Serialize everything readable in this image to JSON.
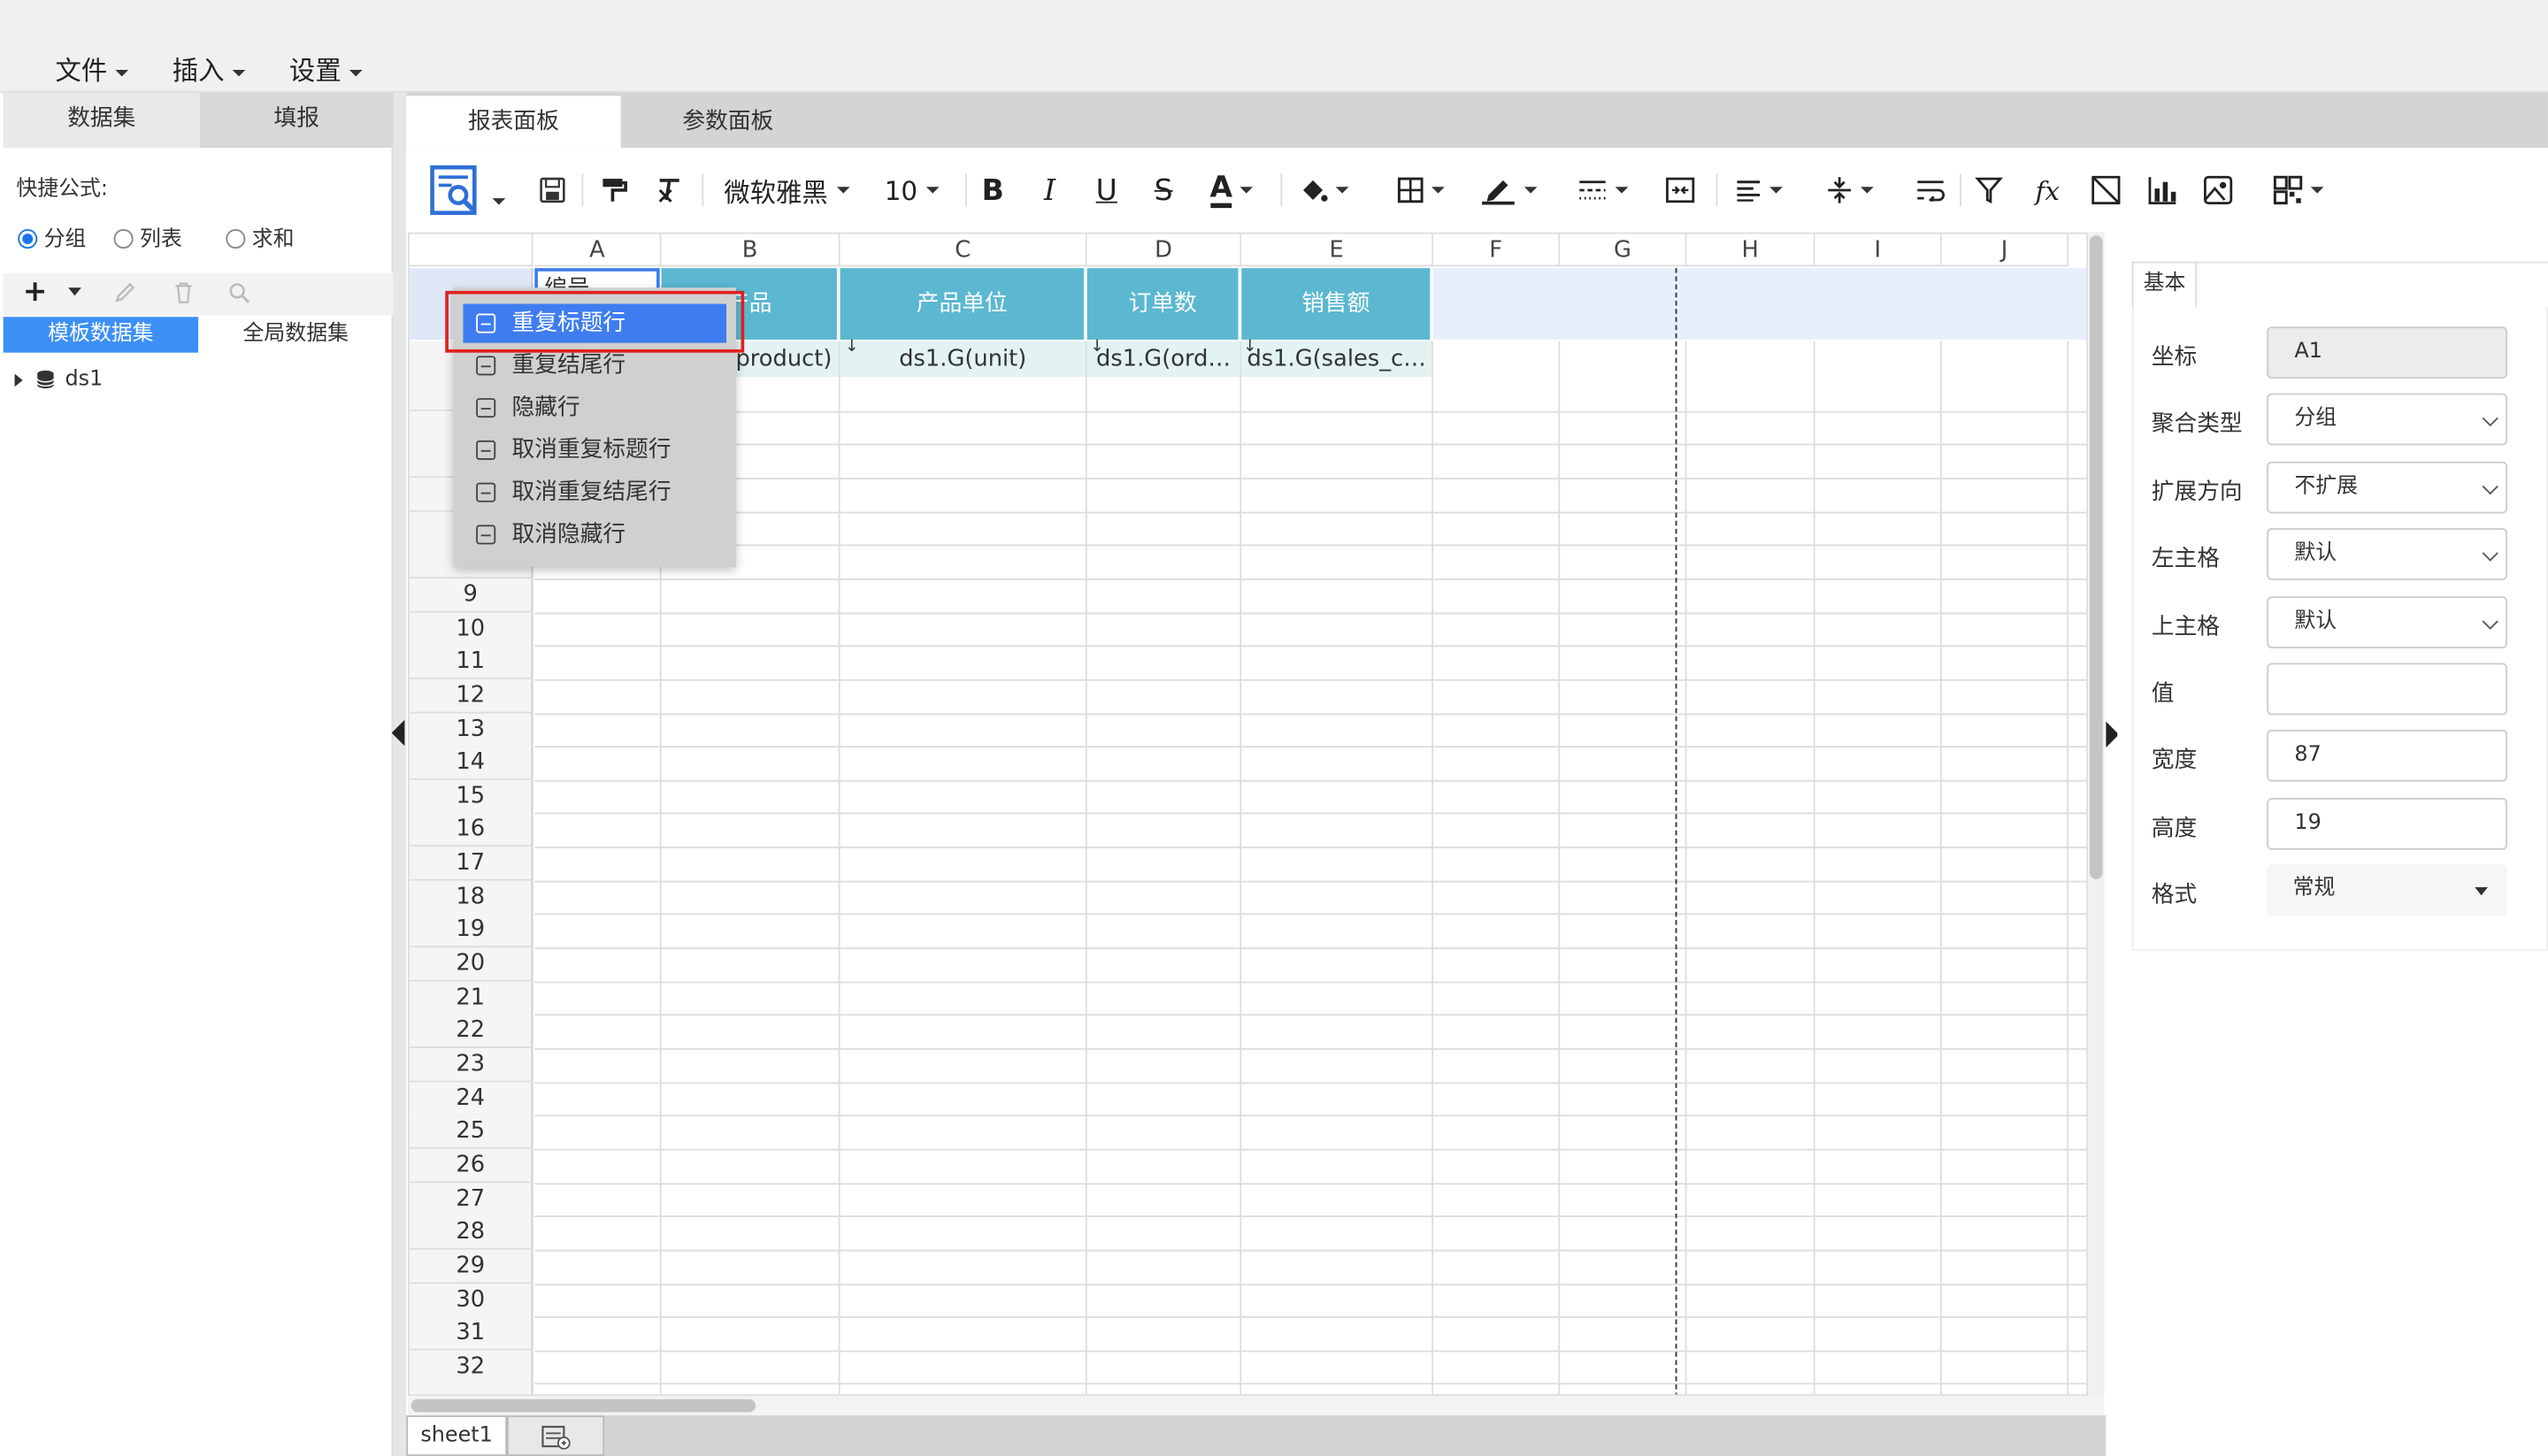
{
  "menu": {
    "file": "文件",
    "insert": "插入",
    "settings": "设置"
  },
  "left_tabs": {
    "dataset": "数据集",
    "fill": "填报"
  },
  "quick_formula": {
    "label": "快捷公式:",
    "options": [
      "分组",
      "列表",
      "求和"
    ],
    "selected": "分组"
  },
  "dataset_tabs": {
    "template": "模板数据集",
    "global": "全局数据集"
  },
  "tree": {
    "root": "ds1"
  },
  "right_tabs": {
    "report": "报表面板",
    "param": "参数面板"
  },
  "toolbar": {
    "font_name": "微软雅黑",
    "font_size": "10",
    "bold": "B",
    "italic": "I",
    "underline": "U",
    "strike": "S",
    "font_color": "A",
    "fx": "fx"
  },
  "sheet": {
    "columns": [
      "A",
      "B",
      "C",
      "D",
      "E",
      "F",
      "G",
      "H",
      "I",
      "J"
    ],
    "visible_rows": [
      "9",
      "10",
      "11",
      "12",
      "13",
      "14",
      "15",
      "16",
      "17",
      "18",
      "19",
      "20",
      "21",
      "22",
      "23",
      "24",
      "25",
      "26",
      "27",
      "28",
      "29",
      "30",
      "31",
      "32"
    ],
    "header_row": [
      "编号",
      "产品",
      "产品单位",
      "订单数",
      "销售额"
    ],
    "data_row": [
      "",
      "product)",
      "ds1.G(unit)",
      "ds1.G(ord…",
      "ds1.G(sales_c…"
    ]
  },
  "context_menu": {
    "items": [
      "重复标题行",
      "重复结尾行",
      "隐藏行",
      "取消重复标题行",
      "取消重复结尾行",
      "取消隐藏行"
    ],
    "selected_index": 0
  },
  "sheet_tab": "sheet1",
  "properties": {
    "tab": "基本",
    "fields": [
      {
        "label": "坐标",
        "value": "A1",
        "type": "readonly"
      },
      {
        "label": "聚合类型",
        "value": "分组",
        "type": "select"
      },
      {
        "label": "扩展方向",
        "value": "不扩展",
        "type": "select"
      },
      {
        "label": "左主格",
        "value": "默认",
        "type": "select"
      },
      {
        "label": "上主格",
        "value": "默认",
        "type": "select"
      },
      {
        "label": "值",
        "value": "",
        "type": "text"
      },
      {
        "label": "宽度",
        "value": "87",
        "type": "text"
      },
      {
        "label": "高度",
        "value": "19",
        "type": "text"
      },
      {
        "label": "格式",
        "value": "常规",
        "type": "dropdown"
      }
    ]
  },
  "colors": {
    "accent": "#1a73e8",
    "header_fill": "#5bb8d0",
    "data_fill": "#e2f3f2",
    "menu_selected": "#3e7cf0",
    "highlight_box": "#e02020"
  }
}
